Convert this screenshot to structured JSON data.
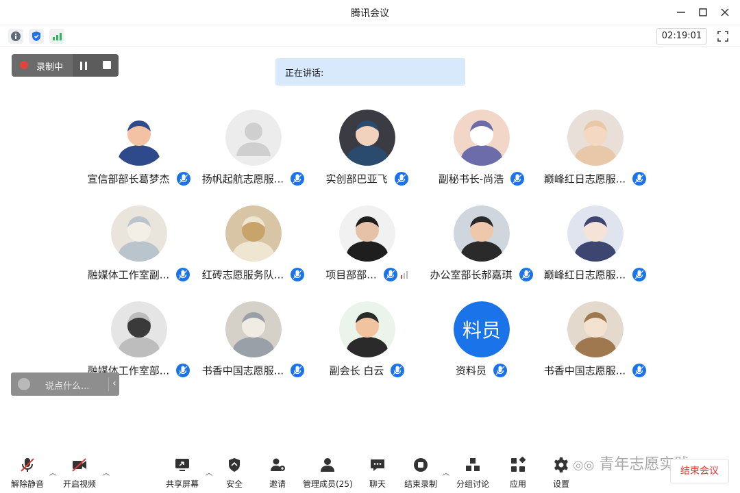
{
  "app": {
    "title": "腾讯会议"
  },
  "info": {
    "timer": "02:19:01"
  },
  "recording": {
    "label": "录制中"
  },
  "speaking": {
    "label": "正在讲话:"
  },
  "participants": [
    {
      "name": "宣信部部长葛梦杰",
      "avatar": "anime-character"
    },
    {
      "name": "扬帆起航志愿服...",
      "avatar": "default-user"
    },
    {
      "name": "实创部巴亚飞",
      "avatar": "girl-portrait"
    },
    {
      "name": "副秘书长-尚浩",
      "avatar": "shark-cartoon"
    },
    {
      "name": "巅峰红日志愿服...",
      "avatar": "baby-face"
    },
    {
      "name": "融媒体工作室副...",
      "avatar": "cat-photo"
    },
    {
      "name": "红砖志愿服务队...",
      "avatar": "plush-toy"
    },
    {
      "name": "项目部部...",
      "avatar": "boy-photo",
      "speaking": true
    },
    {
      "name": "办公室部长郝嘉琪",
      "avatar": "boy-smile"
    },
    {
      "name": "巅峰红日志愿服...",
      "avatar": "anime-boy"
    },
    {
      "name": "融媒体工作室部...",
      "avatar": "gray-photo"
    },
    {
      "name": "书香中国志愿服...",
      "avatar": "cat-face"
    },
    {
      "name": "副会长 白云",
      "avatar": "cartoon-boy"
    },
    {
      "name": "资料员",
      "avatar": "text",
      "avatar_text": "料员"
    },
    {
      "name": "书香中国志愿服...",
      "avatar": "teddy-bear"
    }
  ],
  "chat": {
    "placeholder": "说点什么..."
  },
  "toolbar": {
    "unmute": "解除静音",
    "video": "开启视频",
    "share": "共享屏幕",
    "security": "安全",
    "invite": "邀请",
    "members": "管理成员(25)",
    "chat": "聊天",
    "end_recording": "结束录制",
    "breakout": "分组讨论",
    "apps": "应用",
    "settings": "设置",
    "end_meeting": "结束会议"
  },
  "watermark": "青年志愿实践",
  "colors": {
    "accent_blue": "#1a73e8",
    "end_red": "#e53935",
    "rec_red": "#e0453a",
    "speaking_bg": "#d7e9fb"
  }
}
